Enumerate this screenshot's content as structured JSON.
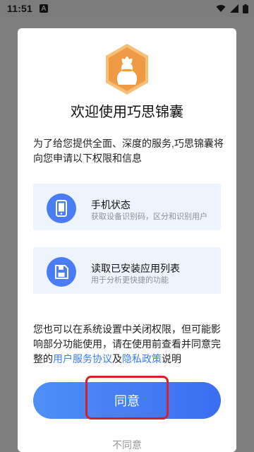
{
  "status_bar": {
    "time": "11:51",
    "notification_icon": "A",
    "icons": [
      "wifi-icon",
      "signal-icon",
      "battery-icon"
    ]
  },
  "dialog": {
    "title": "欢迎使用巧思锦囊",
    "intro": "为了给您提供全面、深度的服务,巧思锦囊将向您申请以下权限和信息",
    "permissions": [
      {
        "icon": "phone-icon",
        "title": "手机状态",
        "description": "获取设备识别码，区分和识别用户"
      },
      {
        "icon": "storage-icon",
        "title": "读取已安装应用列表",
        "description": "用于分析更快捷的功能"
      }
    ],
    "notice_part1": "您也可以在系统设置中关闭权限，但可能影响部分功能使用，请在使用前查看并同意完整的",
    "user_agreement_link": "用户服务协议",
    "and_text": "及",
    "privacy_policy_link": "隐私政策",
    "notice_part2": "说明",
    "agree_label": "同意",
    "disagree_label": "不同意"
  },
  "colors": {
    "accent": "#4a7df4",
    "link": "#3b7cf0",
    "highlight": "#d8202b",
    "logo_orange": "#f0a04b"
  }
}
